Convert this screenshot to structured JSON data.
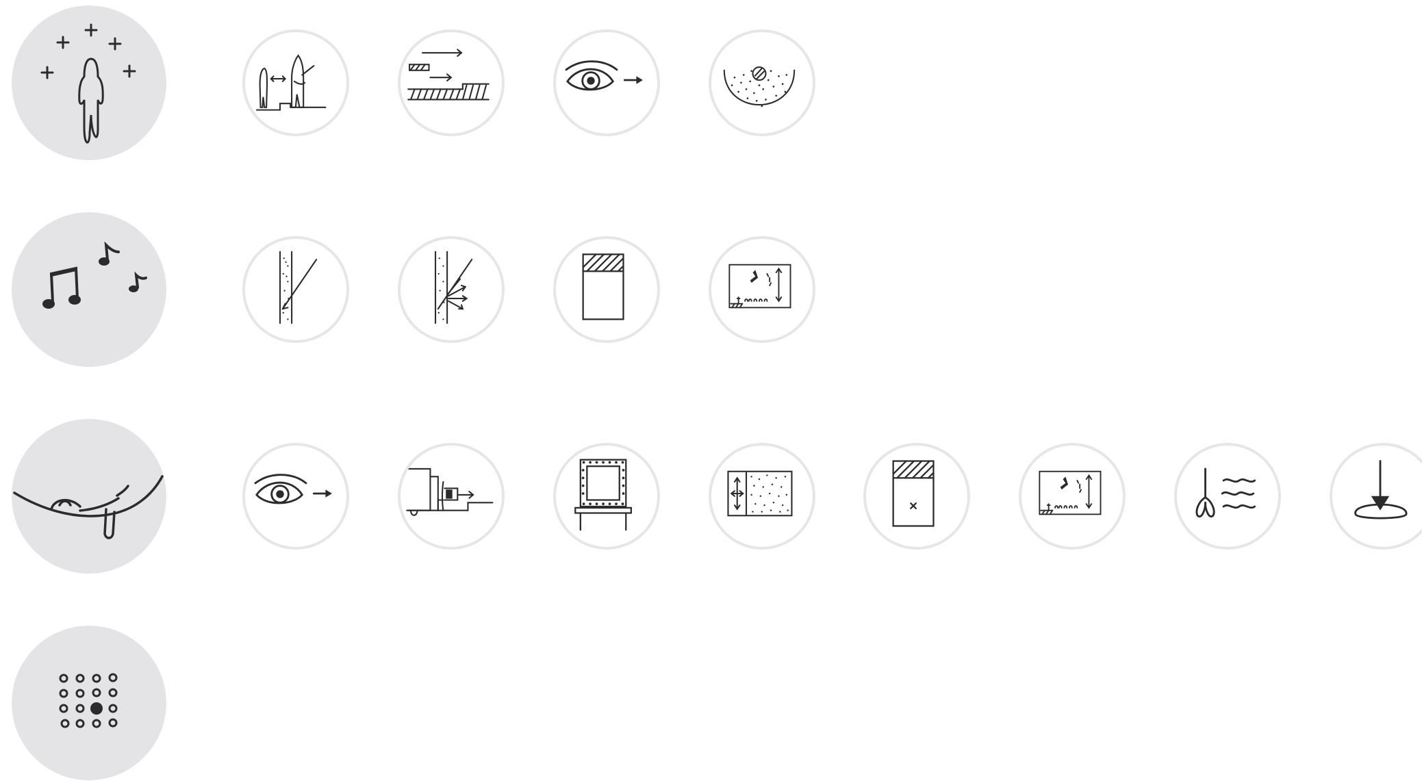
{
  "colors": {
    "category_fill": "#e4e4e7",
    "ring": "#e6e6e8",
    "ink": "#2b2b2b"
  },
  "rows": [
    {
      "category_icon": "person-with-sparkles-icon",
      "steps": [
        "scale-comparison-icon",
        "moving-walkway-icon",
        "eye-looking-forward-icon",
        "dotted-dome-icon"
      ]
    },
    {
      "category_icon": "music-notes-icon",
      "steps": [
        "textured-wall-line-icon",
        "wall-reflection-icon",
        "hatched-panel-icon",
        "room-section-icon"
      ]
    },
    {
      "category_icon": "person-in-hammock-icon",
      "steps": [
        "eye-looking-forward-icon",
        "furniture-section-icon",
        "framed-mirror-icon",
        "sliding-panel-icon",
        "panel-with-x-icon",
        "room-section-icon",
        "plant-and-waves-icon",
        "arrow-into-pool-icon"
      ]
    },
    {
      "category_icon": "dot-grid-icon",
      "steps": []
    }
  ]
}
